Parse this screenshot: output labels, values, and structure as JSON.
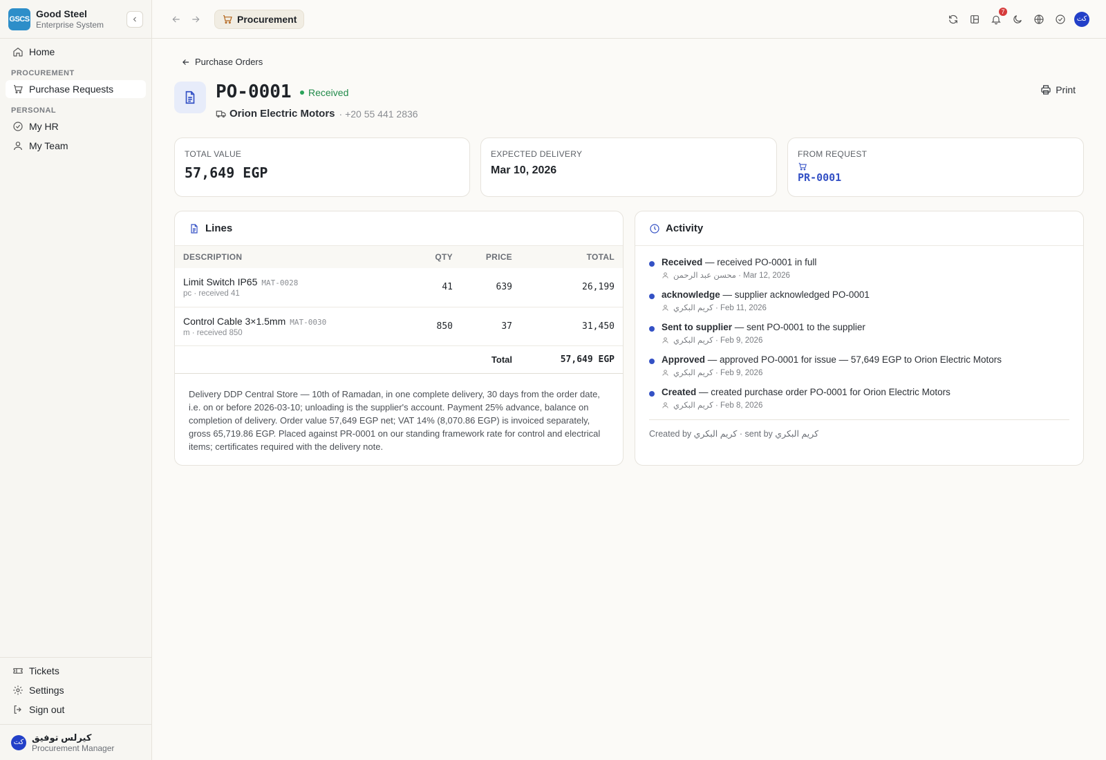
{
  "brand": {
    "logo_text": "GSCS",
    "name": "Good Steel",
    "subtitle": "Enterprise System"
  },
  "sidebar": {
    "home": "Home",
    "section_procurement": "PROCUREMENT",
    "purchase_requests": "Purchase Requests",
    "section_personal": "PERSONAL",
    "my_hr": "My HR",
    "my_team": "My Team",
    "tickets": "Tickets",
    "settings": "Settings",
    "sign_out": "Sign out"
  },
  "user": {
    "initials": "كت",
    "name": "كيرلس توفيق",
    "role": "Procurement Manager"
  },
  "topbar": {
    "module": "Procurement",
    "notification_count": "7",
    "avatar_initials": "كت"
  },
  "page": {
    "back_label": "Purchase Orders",
    "po_number": "PO-0001",
    "status": "Received",
    "supplier_name": "Orion Electric Motors",
    "supplier_phone": "· +20 55 441 2836",
    "print_label": "Print"
  },
  "stats": {
    "total_value_label": "TOTAL VALUE",
    "total_value": "57,649 EGP",
    "expected_delivery_label": "EXPECTED DELIVERY",
    "expected_delivery": "Mar 10, 2026",
    "from_request_label": "FROM REQUEST",
    "from_request": "PR-0001"
  },
  "lines": {
    "title": "Lines",
    "headers": {
      "description": "DESCRIPTION",
      "qty": "QTY",
      "price": "PRICE",
      "total": "TOTAL"
    },
    "rows": [
      {
        "name": "Limit Switch IP65",
        "code": "MAT-0028",
        "sub": "pc · received 41",
        "qty": "41",
        "price": "639",
        "total": "26,199"
      },
      {
        "name": "Control Cable 3×1.5mm",
        "code": "MAT-0030",
        "sub": "m · received 850",
        "qty": "850",
        "price": "37",
        "total": "31,450"
      }
    ],
    "total_label": "Total",
    "total_value": "57,649 EGP",
    "note": "Delivery DDP Central Store — 10th of Ramadan, in one complete delivery, 30 days from the order date, i.e. on or before 2026-03-10; unloading is the supplier's account. Payment 25% advance, balance on completion of delivery. Order value 57,649 EGP net; VAT 14% (8,070.86 EGP) is invoiced separately, gross 65,719.86 EGP. Placed against PR-0001 on our standing framework rate for control and electrical items; certificates required with the delivery note."
  },
  "activity": {
    "title": "Activity",
    "items": [
      {
        "title": "Received",
        "text": " — received PO-0001 in full",
        "meta": "محسن عبد الرحمن · Mar 12, 2026"
      },
      {
        "title": "acknowledge",
        "text": " — supplier acknowledged PO-0001",
        "meta": "كريم البكري · Feb 11, 2026"
      },
      {
        "title": "Sent to supplier",
        "text": " — sent PO-0001 to the supplier",
        "meta": "كريم البكري · Feb 9, 2026"
      },
      {
        "title": "Approved",
        "text": " — approved PO-0001 for issue — 57,649 EGP to Orion Electric Motors",
        "meta": "كريم البكري · Feb 9, 2026"
      },
      {
        "title": "Created",
        "text": " — created purchase order PO-0001 for Orion Electric Motors",
        "meta": "كريم البكري · Feb 8, 2026"
      }
    ],
    "footer": "Created by كريم البكري · sent by كريم البكري"
  },
  "colors": {
    "accent": "#3451c5",
    "status_green": "#218a4a",
    "brand_logo": "#2d8ec9"
  }
}
